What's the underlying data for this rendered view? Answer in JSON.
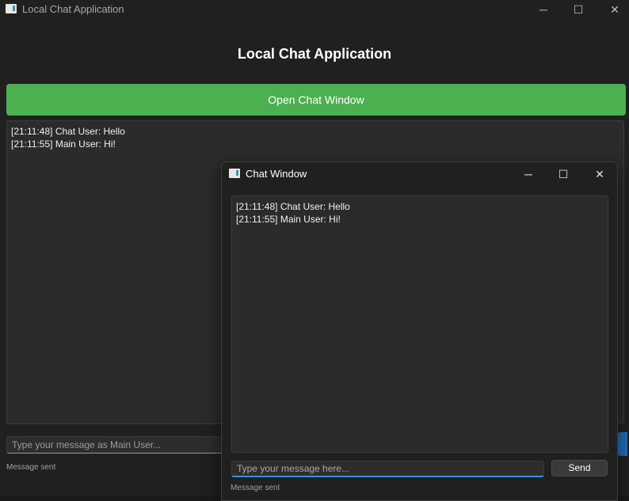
{
  "main_window": {
    "title": "Local Chat Application",
    "heading": "Local Chat Application",
    "open_chat_label": "Open Chat Window",
    "messages": [
      "[21:11:48] Chat User: Hello",
      "[21:11:55] Main User: Hi!"
    ],
    "input_placeholder": "Type your message as Main User...",
    "status": "Message sent",
    "accent_color": "#4caf50",
    "send_color": "#1f6fba",
    "controls": {
      "minimize": "─",
      "maximize": "☐",
      "close": "✕"
    }
  },
  "chat_window": {
    "title": "Chat Window",
    "messages": [
      "[21:11:48] Chat User: Hello",
      "[21:11:55] Main User: Hi!"
    ],
    "input_placeholder": "Type your message here...",
    "send_label": "Send",
    "status": "Message sent",
    "controls": {
      "minimize": "─",
      "maximize": "☐",
      "close": "✕"
    }
  }
}
